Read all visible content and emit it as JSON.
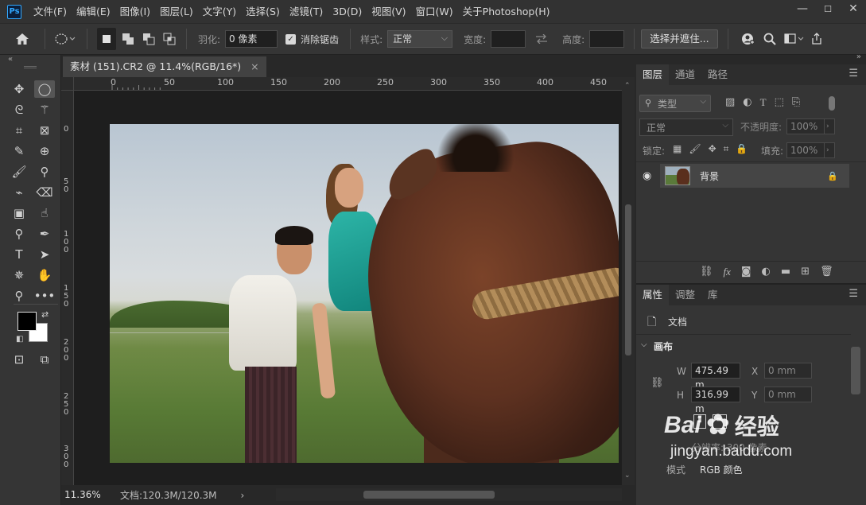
{
  "app": {
    "logo": "Ps",
    "menu": [
      "文件(F)",
      "编辑(E)",
      "图像(I)",
      "图层(L)",
      "文字(Y)",
      "选择(S)",
      "滤镜(T)",
      "3D(D)",
      "视图(V)",
      "窗口(W)",
      "关于Photoshop(H)"
    ],
    "window_controls": {
      "minimize": "—",
      "maximize": "☐",
      "close": "✕"
    }
  },
  "options": {
    "feather_label": "羽化:",
    "feather_value": "0 像素",
    "antialias_label": "消除锯齿",
    "antialias_checked": "✓",
    "style_label": "样式:",
    "style_value": "正常",
    "width_label": "宽度:",
    "height_label": "高度:",
    "mask_button": "选择并遮住..."
  },
  "document": {
    "tab_title": "素材 (151).CR2 @ 11.4%(RGB/16*)",
    "close": "×",
    "ruler_top_labels": [
      "0",
      "50",
      "100",
      "150",
      "200",
      "250",
      "300",
      "350",
      "400",
      "450"
    ],
    "ruler_left_labels": [
      "0",
      "5\n0",
      "1\n0\n0",
      "1\n5\n0",
      "2\n0\n0",
      "2\n5\n0",
      "3\n0\n0"
    ],
    "zoom": "11.36%",
    "doc_info": "文档:120.3M/120.3M",
    "status_arrow": "›"
  },
  "layers_panel": {
    "tabs": [
      "图层",
      "通道",
      "路径"
    ],
    "filter_label": "类型",
    "blend_mode": "正常",
    "opacity_label": "不透明度:",
    "opacity_value": "100%",
    "lock_label": "锁定:",
    "fill_label": "填充:",
    "fill_value": "100%",
    "layers": [
      {
        "name": "背景"
      }
    ]
  },
  "properties_panel": {
    "tabs": [
      "属性",
      "调整",
      "库"
    ],
    "doc_label": "文档",
    "canvas_label": "画布",
    "w_label": "W",
    "w_value": "475.49 m",
    "h_label": "H",
    "h_value": "316.99 m",
    "x_label": "X",
    "x_value": "0 mm",
    "y_label": "Y",
    "y_value": "0 mm",
    "resolution_partial": "分辨率: 300 像素",
    "mode_label": "模式",
    "mode_value": "RGB 颜色"
  },
  "watermark": {
    "brand": "Bai",
    "cn": "经验",
    "url": "jingyan.baidu.com"
  }
}
